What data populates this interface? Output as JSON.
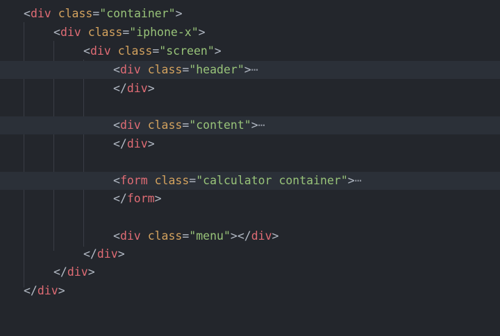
{
  "editor": {
    "colors": {
      "background": "#23262c",
      "highlight": "#2b3038",
      "tag": "#e06c75",
      "attribute": "#d3a25e",
      "string": "#98c379",
      "punctuation": "#b3bac5"
    },
    "fold_icon": "fold-ellipsis-icon",
    "lines": [
      {
        "kind": "open",
        "tag": "div",
        "attr": "class",
        "value": "\"container\""
      },
      {
        "kind": "open",
        "tag": "div",
        "attr": "class",
        "value": "\"iphone-x\""
      },
      {
        "kind": "open",
        "tag": "div",
        "attr": "class",
        "value": "\"screen\""
      },
      {
        "kind": "open",
        "tag": "div",
        "attr": "class",
        "value": "\"header\"",
        "fold": "⋯"
      },
      {
        "kind": "close",
        "tag": "div"
      },
      {
        "kind": "blank"
      },
      {
        "kind": "open",
        "tag": "div",
        "attr": "class",
        "value": "\"content\"",
        "fold": "⋯"
      },
      {
        "kind": "close",
        "tag": "div"
      },
      {
        "kind": "blank"
      },
      {
        "kind": "open",
        "tag": "form",
        "attr": "class",
        "value": "\"calculator container\"",
        "fold": "⋯"
      },
      {
        "kind": "close",
        "tag": "form"
      },
      {
        "kind": "blank"
      },
      {
        "kind": "inline",
        "tag": "div",
        "attr": "class",
        "value": "\"menu\"",
        "close_tag": "div"
      },
      {
        "kind": "close",
        "tag": "div"
      },
      {
        "kind": "close",
        "tag": "div"
      },
      {
        "kind": "close",
        "tag": "div"
      }
    ]
  }
}
